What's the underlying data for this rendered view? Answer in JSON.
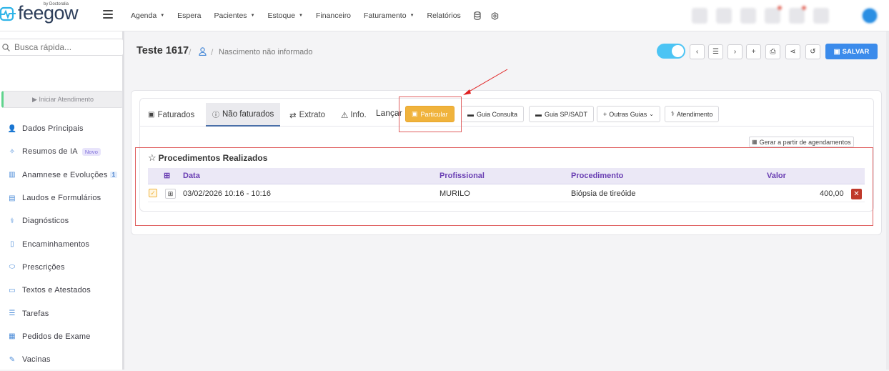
{
  "brand": {
    "name": "feegow",
    "byline": "by Doctoralia"
  },
  "nav": [
    {
      "label": "Agenda",
      "caret": true
    },
    {
      "label": "Espera",
      "caret": false
    },
    {
      "label": "Pacientes",
      "caret": true
    },
    {
      "label": "Estoque",
      "caret": true
    },
    {
      "label": "Financeiro",
      "caret": false
    },
    {
      "label": "Faturamento",
      "caret": true
    },
    {
      "label": "Relatórios",
      "caret": false
    }
  ],
  "search": {
    "placeholder": "Busca rápida..."
  },
  "sidebar": {
    "start_label": "▶ Iniciar Atendimento",
    "items": [
      {
        "label": "Dados Principais",
        "icon": "user-icon"
      },
      {
        "label": "Resumos de IA",
        "icon": "sparkle-icon",
        "badge": "Novo"
      },
      {
        "label": "Anamnese e Evoluções",
        "icon": "chart-icon",
        "count": "1"
      },
      {
        "label": "Laudos e Formulários",
        "icon": "clipboard-icon"
      },
      {
        "label": "Diagnósticos",
        "icon": "stethoscope-icon"
      },
      {
        "label": "Encaminhamentos",
        "icon": "file-icon"
      },
      {
        "label": "Prescrições",
        "icon": "pills-icon"
      },
      {
        "label": "Textos e Atestados",
        "icon": "document-icon"
      },
      {
        "label": "Tarefas",
        "icon": "tasks-icon"
      },
      {
        "label": "Pedidos de Exame",
        "icon": "building-icon"
      },
      {
        "label": "Vacinas",
        "icon": "syringe-icon"
      }
    ]
  },
  "header": {
    "patient_name": "Teste 1617",
    "sep": "/",
    "birth": "Nascimento não informado",
    "save_label": "SALVAR"
  },
  "tabs": {
    "faturados": "Faturados",
    "nao_faturados": "Não faturados",
    "extrato": "Extrato",
    "info": "Info.",
    "lancar": "Lançar"
  },
  "buttons": {
    "particular": "Particular",
    "guia_consulta": "Guia Consulta",
    "guia_sp_sadt": "Guia SP/SADT",
    "outras_guias": "Outras Guias",
    "atendimento": "Atendimento",
    "gerar": "Gerar a partir de agendamentos"
  },
  "procedures": {
    "title": "Procedimentos Realizados",
    "columns": {
      "data": "Data",
      "profissional": "Profissional",
      "procedimento": "Procedimento",
      "valor": "Valor"
    },
    "rows": [
      {
        "data": "03/02/2026 10:16 - 10:16",
        "profissional": "MURILO",
        "procedimento": "Biópsia de tireóide",
        "valor": "400,00"
      }
    ]
  },
  "colors": {
    "accent": "#3b8beb",
    "orange": "#f0b33c",
    "annotation": "#e06060",
    "table_header": "#6a3fb3"
  }
}
